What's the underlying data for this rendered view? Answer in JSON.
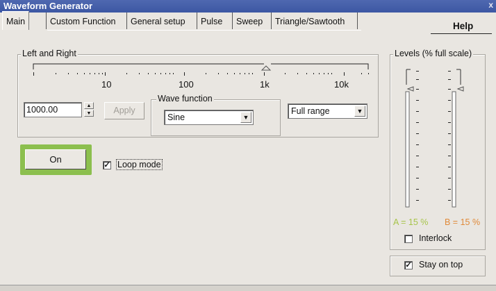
{
  "window": {
    "title": "Waveform Generator",
    "close_glyph": "x"
  },
  "tabs": [
    {
      "label": "Main",
      "active": true
    },
    {
      "label": "Custom Function",
      "active": false
    },
    {
      "label": "General setup",
      "active": false
    },
    {
      "label": "Pulse",
      "active": false
    },
    {
      "label": "Sweep",
      "active": false
    },
    {
      "label": "Triangle/Sawtooth",
      "active": false
    }
  ],
  "help_label": "Help",
  "frequency_group": {
    "legend": "Left and Right",
    "tick_labels": [
      "10",
      "100",
      "1k",
      "10k"
    ],
    "value": "1000.00",
    "apply_label": "Apply",
    "range_select": "Full range"
  },
  "wave_function": {
    "legend": "Wave function",
    "selected": "Sine"
  },
  "on_button": "On",
  "loop_mode": {
    "label": "Loop mode",
    "checked": true
  },
  "levels": {
    "legend": "Levels (% full scale)",
    "a_label": "A = 15 %",
    "b_label": "B = 15 %",
    "a_percent": 15,
    "b_percent": 15,
    "a_color": "#a7c44a",
    "b_color": "#e08a3a"
  },
  "interlock": {
    "label": "Interlock",
    "checked": false
  },
  "stay_on_top": {
    "label": "Stay on top",
    "checked": true
  },
  "icons": {
    "check": "✓",
    "spin_up": "▲",
    "spin_down": "▼",
    "dropdown": "▼"
  }
}
